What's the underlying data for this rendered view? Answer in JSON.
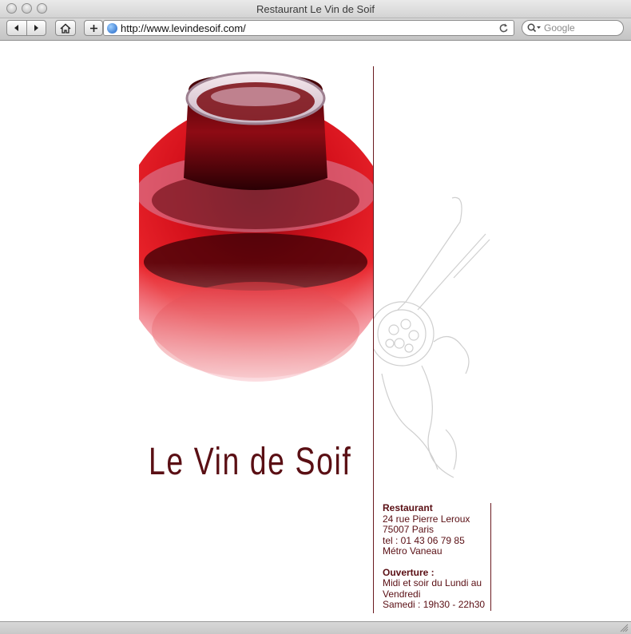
{
  "window": {
    "title": "Restaurant Le Vin de Soif"
  },
  "toolbar": {
    "url": "http://www.levindesoif.com/",
    "search_placeholder": "Google"
  },
  "page": {
    "logo": "Le Vin de Soif",
    "info": {
      "restaurant_heading": "Restaurant",
      "address_line1": "24 rue Pierre Leroux",
      "address_line2": "75007 Paris",
      "phone": "tel : 01 43 06 79 85",
      "metro": "Métro Vaneau",
      "hours_heading": "Ouverture :",
      "hours_line1": "Midi et soir du Lundi au",
      "hours_line2": "Vendredi",
      "hours_line3": "Samedi : 19h30 - 22h30"
    }
  },
  "colors": {
    "brand": "#5a0f14",
    "wine": "#b3101c",
    "divider": "#6a1a1f"
  }
}
